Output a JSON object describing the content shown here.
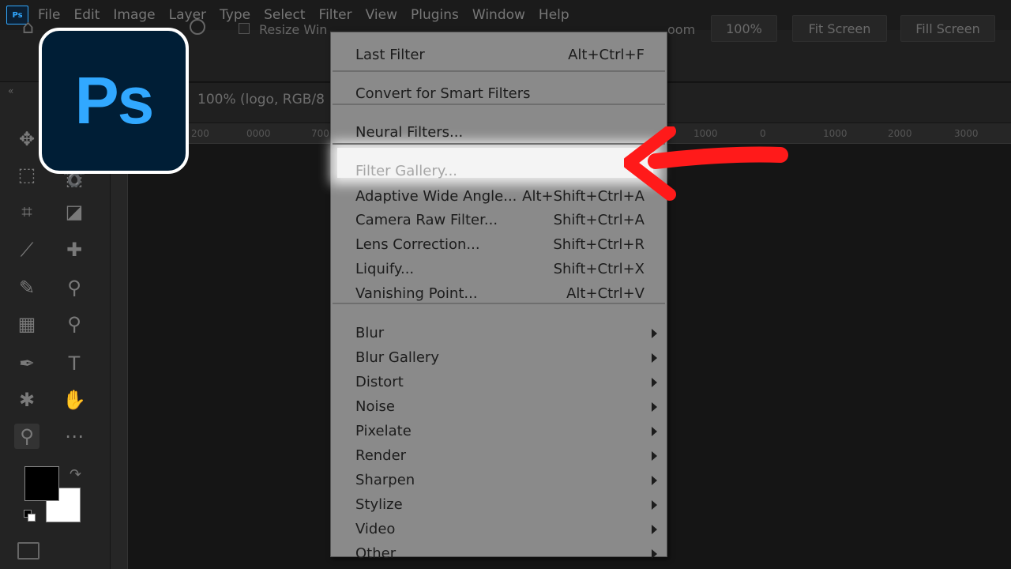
{
  "menubar": {
    "app_badge": "Ps",
    "items": [
      "File",
      "Edit",
      "Image",
      "Layer",
      "Type",
      "Select",
      "Filter",
      "View",
      "Plugins",
      "Window",
      "Help"
    ]
  },
  "options": {
    "resize_label": "Resize Win",
    "zoom_label": "oom",
    "zoom_value": "100%",
    "fit_screen": "Fit Screen",
    "fill_screen": "Fill Screen"
  },
  "document": {
    "tab_title": "100% (logo, RGB/8"
  },
  "ruler_ticks": [
    "200",
    "0000",
    "700",
    "1000",
    "0",
    "1000",
    "2000",
    "3000"
  ],
  "logo": {
    "text": "Ps"
  },
  "filter_menu": {
    "groups": [
      [
        {
          "label": "Last Filter",
          "shortcut": "Alt+Ctrl+F"
        }
      ],
      [
        {
          "label": "Convert for Smart Filters",
          "shortcut": ""
        }
      ],
      [
        {
          "label": "Neural Filters...",
          "shortcut": ""
        }
      ],
      [
        {
          "label": "Filter Gallery...",
          "shortcut": "",
          "disabled": true,
          "highlighted": true
        },
        {
          "label": "Adaptive Wide Angle...",
          "shortcut": "Alt+Shift+Ctrl+A"
        },
        {
          "label": "Camera Raw Filter...",
          "shortcut": "Shift+Ctrl+A"
        },
        {
          "label": "Lens Correction...",
          "shortcut": "Shift+Ctrl+R"
        },
        {
          "label": "Liquify...",
          "shortcut": "Shift+Ctrl+X"
        },
        {
          "label": "Vanishing Point...",
          "shortcut": "Alt+Ctrl+V"
        }
      ],
      [
        {
          "label": "Blur",
          "submenu": true
        },
        {
          "label": "Blur Gallery",
          "submenu": true
        },
        {
          "label": "Distort",
          "submenu": true
        },
        {
          "label": "Noise",
          "submenu": true
        },
        {
          "label": "Pixelate",
          "submenu": true
        },
        {
          "label": "Render",
          "submenu": true
        },
        {
          "label": "Sharpen",
          "submenu": true
        },
        {
          "label": "Stylize",
          "submenu": true
        },
        {
          "label": "Video",
          "submenu": true
        },
        {
          "label": "Other",
          "submenu": true
        }
      ]
    ]
  },
  "tools": [
    {
      "icon": "move-icon",
      "glyph": "✥"
    },
    {
      "icon": "artboard-icon",
      "glyph": "⬚"
    },
    {
      "icon": "marquee-icon",
      "glyph": "⬚"
    },
    {
      "icon": "lasso-icon",
      "glyph": "➰"
    },
    {
      "icon": "crop-icon",
      "glyph": "⌗"
    },
    {
      "icon": "frame-icon",
      "glyph": "◪"
    },
    {
      "icon": "eyedropper-icon",
      "glyph": "⟋"
    },
    {
      "icon": "healing-brush-icon",
      "glyph": "✚"
    },
    {
      "icon": "brush-icon",
      "glyph": "✎"
    },
    {
      "icon": "clone-stamp-icon",
      "glyph": "⚲"
    },
    {
      "icon": "gradient-icon",
      "glyph": "▦"
    },
    {
      "icon": "dodge-icon",
      "glyph": "⚲"
    },
    {
      "icon": "pen-icon",
      "glyph": "✒"
    },
    {
      "icon": "type-icon",
      "glyph": "T"
    },
    {
      "icon": "shape-icon",
      "glyph": "✱"
    },
    {
      "icon": "hand-icon",
      "glyph": "✋"
    },
    {
      "icon": "zoom-icon",
      "glyph": "⚲"
    },
    {
      "icon": "more-tools-icon",
      "glyph": "⋯"
    }
  ],
  "colors": {
    "foreground": "#000000",
    "background": "#ffffff",
    "accent": "#31a8ff",
    "arrow": "#ff1a1a"
  }
}
